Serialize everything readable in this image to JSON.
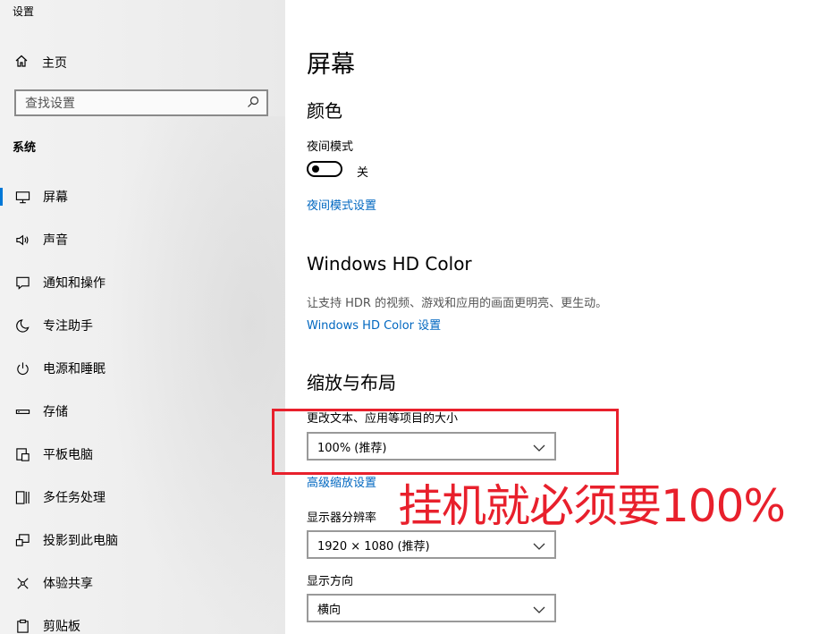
{
  "window": {
    "title": "设置"
  },
  "sidebar": {
    "home_label": "主页",
    "search_placeholder": "查找设置",
    "section_title": "系统",
    "items": [
      {
        "label": "屏幕",
        "icon": "monitor-icon",
        "active": true
      },
      {
        "label": "声音",
        "icon": "speaker-icon"
      },
      {
        "label": "通知和操作",
        "icon": "notification-icon"
      },
      {
        "label": "专注助手",
        "icon": "moon-icon"
      },
      {
        "label": "电源和睡眠",
        "icon": "power-icon"
      },
      {
        "label": "存储",
        "icon": "storage-icon"
      },
      {
        "label": "平板电脑",
        "icon": "tablet-icon"
      },
      {
        "label": "多任务处理",
        "icon": "multitask-icon"
      },
      {
        "label": "投影到此电脑",
        "icon": "project-icon"
      },
      {
        "label": "体验共享",
        "icon": "share-icon"
      },
      {
        "label": "剪贴板",
        "icon": "clipboard-icon"
      }
    ]
  },
  "main": {
    "page_title": "屏幕",
    "color_section": {
      "heading": "颜色",
      "night_mode_label": "夜间模式",
      "night_mode_state": "关",
      "night_mode_on": false,
      "night_mode_link": "夜间模式设置"
    },
    "hdr_section": {
      "heading": "Windows HD Color",
      "description": "让支持 HDR 的视频、游戏和应用的画面更明亮、更生动。",
      "link": "Windows HD Color 设置"
    },
    "layout_section": {
      "heading": "缩放与布局",
      "scale_label": "更改文本、应用等项目的大小",
      "scale_value": "100% (推荐)",
      "advanced_link": "高级缩放设置",
      "resolution_label": "显示器分辨率",
      "resolution_value": "1920 × 1080 (推荐)",
      "orientation_label": "显示方向",
      "orientation_value": "横向"
    }
  },
  "annotation": {
    "text": "挂机就必须要100%",
    "color": "#e8202c"
  },
  "colors": {
    "accent": "#0078d7",
    "link": "#0067c0"
  }
}
